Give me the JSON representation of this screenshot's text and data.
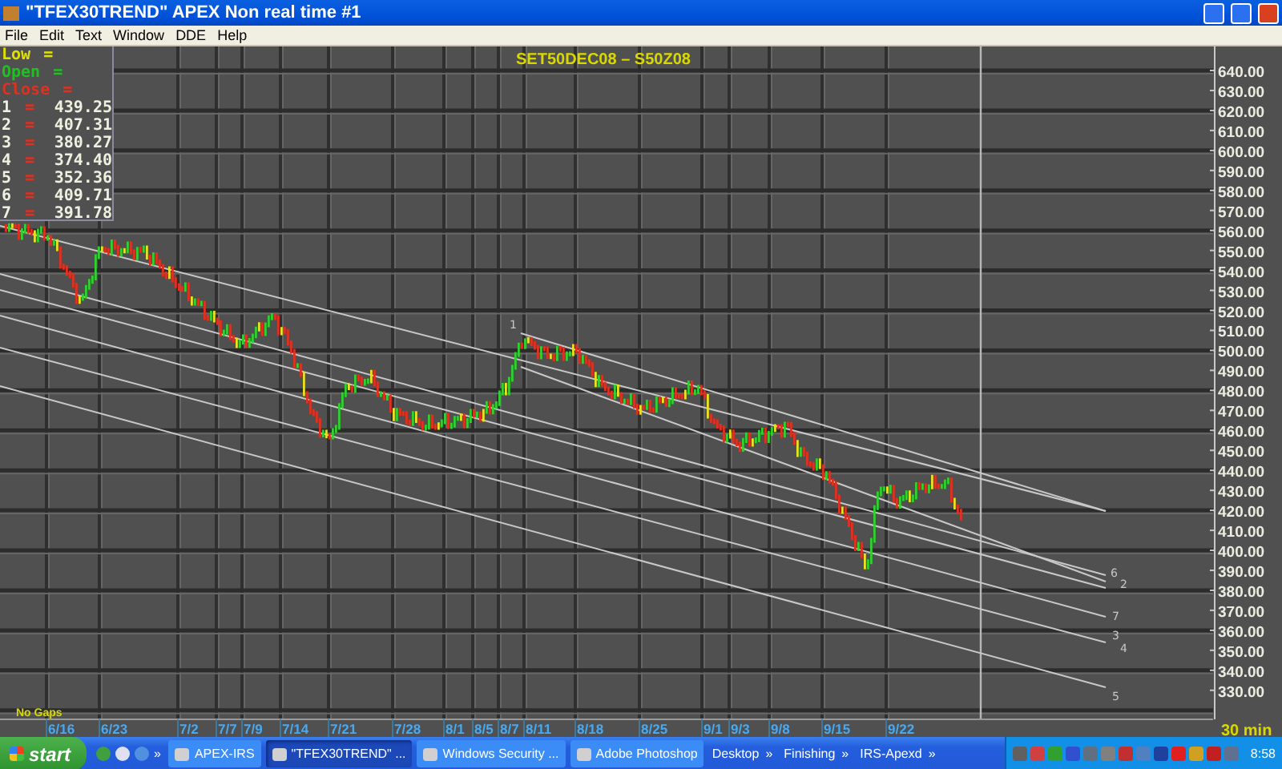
{
  "window": {
    "title": "\"TFEX30TREND\" APEX Non real time #1"
  },
  "menu": [
    "File",
    "Edit",
    "Text",
    "Window",
    "DDE",
    "Help"
  ],
  "chart": {
    "title": "SET50DEC08  –  S50Z08",
    "legend": {
      "fields": [
        {
          "label": "Low",
          "sign": "=",
          "color": "#e0e000"
        },
        {
          "label": "Open",
          "sign": "=",
          "color": "#20c020"
        },
        {
          "label": "Close",
          "sign": "=",
          "color": "#e03020"
        }
      ],
      "rows": [
        {
          "label": "1",
          "sign": "=",
          "value": "439.25"
        },
        {
          "label": "2",
          "sign": "=",
          "value": "407.31"
        },
        {
          "label": "3",
          "sign": "=",
          "value": "380.27"
        },
        {
          "label": "4",
          "sign": "=",
          "value": "374.40"
        },
        {
          "label": "5",
          "sign": "=",
          "value": "352.36"
        },
        {
          "label": "6",
          "sign": "=",
          "value": "409.71"
        },
        {
          "label": "7",
          "sign": "=",
          "value": "391.78"
        }
      ]
    },
    "y_axis": [
      "640.00",
      "630.00",
      "620.00",
      "610.00",
      "600.00",
      "590.00",
      "580.00",
      "570.00",
      "560.00",
      "550.00",
      "540.00",
      "530.00",
      "520.00",
      "510.00",
      "500.00",
      "490.00",
      "480.00",
      "470.00",
      "460.00",
      "450.00",
      "440.00",
      "430.00",
      "420.00",
      "410.00",
      "400.00",
      "390.00",
      "380.00",
      "370.00",
      "360.00",
      "350.00",
      "340.00",
      "330.00"
    ],
    "x_axis": [
      "6/16",
      "6/23",
      "7/2",
      "7/7",
      "7/9",
      "7/14",
      "7/21",
      "7/28",
      "8/1",
      "8/5",
      "8/7",
      "8/11",
      "8/18",
      "8/25",
      "9/1",
      "9/3",
      "9/8",
      "9/15",
      "9/22"
    ],
    "trendline_labels": [
      "1",
      "6",
      "2",
      "7",
      "3",
      "4",
      "5"
    ],
    "gaps_note": "No Gaps",
    "interval": "30 min"
  },
  "taskbar": {
    "start": "start",
    "quick_launch_more": "»",
    "tasks": [
      {
        "label": "APEX-IRS",
        "selected": false
      },
      {
        "label": "\"TFEX30TREND\" ...",
        "selected": true
      },
      {
        "label": "Windows Security ...",
        "selected": false
      },
      {
        "label": "Adobe Photoshop",
        "selected": false
      }
    ],
    "toolbars": [
      {
        "label": "Desktop",
        "more": "»"
      },
      {
        "label": "Finishing",
        "more": "»"
      },
      {
        "label": "IRS-Apexd",
        "more": "»"
      }
    ],
    "clock": "8:58"
  }
}
